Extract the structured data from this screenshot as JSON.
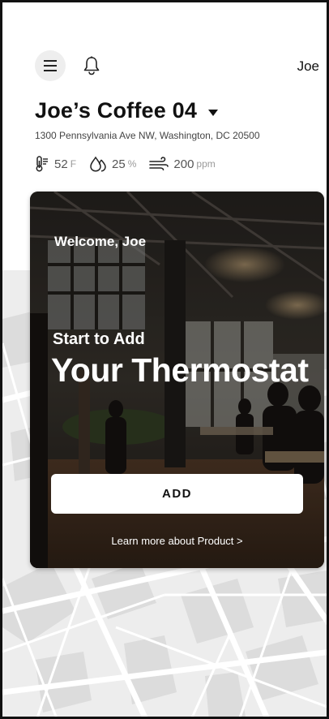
{
  "header": {
    "user_name": "Joe",
    "menu_icon": "hamburger-menu-icon",
    "notification_icon": "bell-icon"
  },
  "location": {
    "name": "Joe’s Coffee 04",
    "address": "1300 Pennsylvania Ave NW, Washington, DC 20500"
  },
  "metrics": {
    "temperature": {
      "value": "52",
      "unit": "F",
      "icon": "thermometer-icon"
    },
    "humidity": {
      "value": "25",
      "unit": "%",
      "icon": "humidity-drop-icon"
    },
    "air_quality": {
      "value": "200",
      "unit": "ppm",
      "icon": "wind-icon"
    }
  },
  "card": {
    "welcome": "Welcome, Joe",
    "subtitle": "Start to Add",
    "title": "Your Thermostat",
    "add_button": "ADD",
    "learn_more": "Learn more about Product >"
  },
  "colors": {
    "text_primary": "#111111",
    "text_secondary": "#555555",
    "menu_button_bg": "#eeeeee",
    "button_bg": "#ffffff"
  }
}
